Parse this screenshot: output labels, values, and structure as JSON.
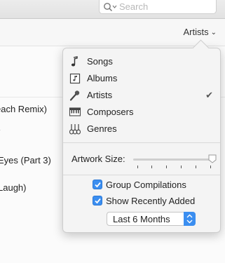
{
  "search": {
    "placeholder": "Search"
  },
  "header": {
    "view_label": "Artists"
  },
  "tracks": [
    {
      "text": "each Remix)"
    },
    {
      "text": "r"
    },
    {
      "text": "Eyes (Part 3)"
    },
    {
      "text": "Laugh)"
    }
  ],
  "menu": {
    "items": [
      {
        "label": "Songs",
        "icon": "music-note-icon",
        "checked": false
      },
      {
        "label": "Albums",
        "icon": "album-icon",
        "checked": false
      },
      {
        "label": "Artists",
        "icon": "microphone-icon",
        "checked": true
      },
      {
        "label": "Composers",
        "icon": "piano-keys-icon",
        "checked": false
      },
      {
        "label": "Genres",
        "icon": "guitars-icon",
        "checked": false
      }
    ],
    "check_glyph": "✔"
  },
  "artwork": {
    "label": "Artwork Size:",
    "level_fraction": 1.0
  },
  "options": {
    "group_compilations": {
      "label": "Group Compilations",
      "checked": true
    },
    "show_recent": {
      "label": "Show Recently Added",
      "checked": true
    },
    "recent_period": "Last 6 Months"
  },
  "colors": {
    "accent": "#3b8ef0"
  }
}
